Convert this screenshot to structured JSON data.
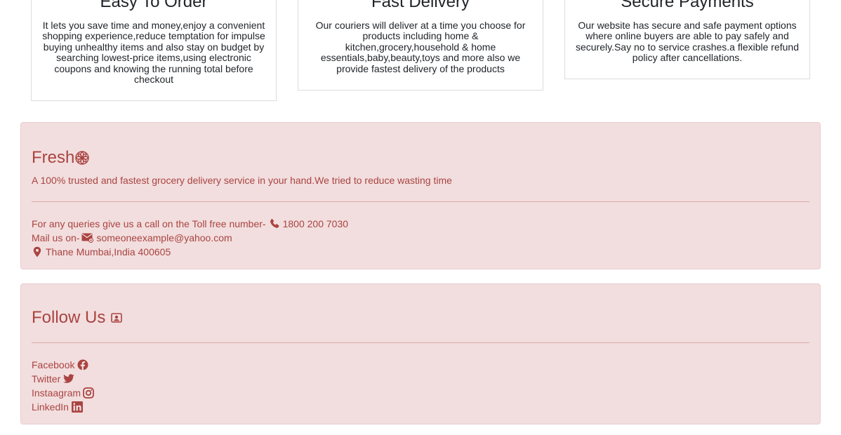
{
  "features": [
    {
      "title": "Easy To Order",
      "text": "It lets you save time and money,enjoy a convenient shopping experience,reduce temptation for impulse buying unhealthy items and also stay on budget by searching lowest-price items,using electronic coupons and knowing the running total before checkout"
    },
    {
      "title": "Fast Delivery",
      "text": "Our couriers will deliver at a time you choose for products including home & kitchen,grocery,household & home essentials,baby,beauty,toys and more also we provide fastest delivery of the products"
    },
    {
      "title": "Secure Payments",
      "text": "Our website has secure and safe payment options where online buyers are able to pay safely and securely.Say no to service crashes.a flexible refund policy after cancellations."
    }
  ],
  "about": {
    "brand": "Fresh",
    "tagline": "A 100% trusted and fastest grocery delivery service in your hand.We tried to reduce wasting time",
    "phone_prefix": "For any queries give us a call on the Toll free number-",
    "phone": "1800 200 7030",
    "mail_prefix": "Mail us on-",
    "email": "someoneexample@yahoo.com",
    "address": "Thane Mumbai,India 400605"
  },
  "follow": {
    "title": "Follow Us",
    "links": [
      "Facebook",
      "Twitter",
      "Instaagram",
      "LinkedIn"
    ]
  },
  "colors": {
    "panel_bg": "#f2dede",
    "panel_text": "#a94442",
    "card_border": "#dcdcdc"
  },
  "icons": {
    "brand": "flower-icon",
    "phone": "phone-icon",
    "mail": "envelope-icon",
    "location": "map-pin-icon",
    "follow": "person-badge-icon",
    "facebook": "facebook-icon",
    "twitter": "twitter-icon",
    "instagram": "instagram-icon",
    "linkedin": "linkedin-icon"
  }
}
